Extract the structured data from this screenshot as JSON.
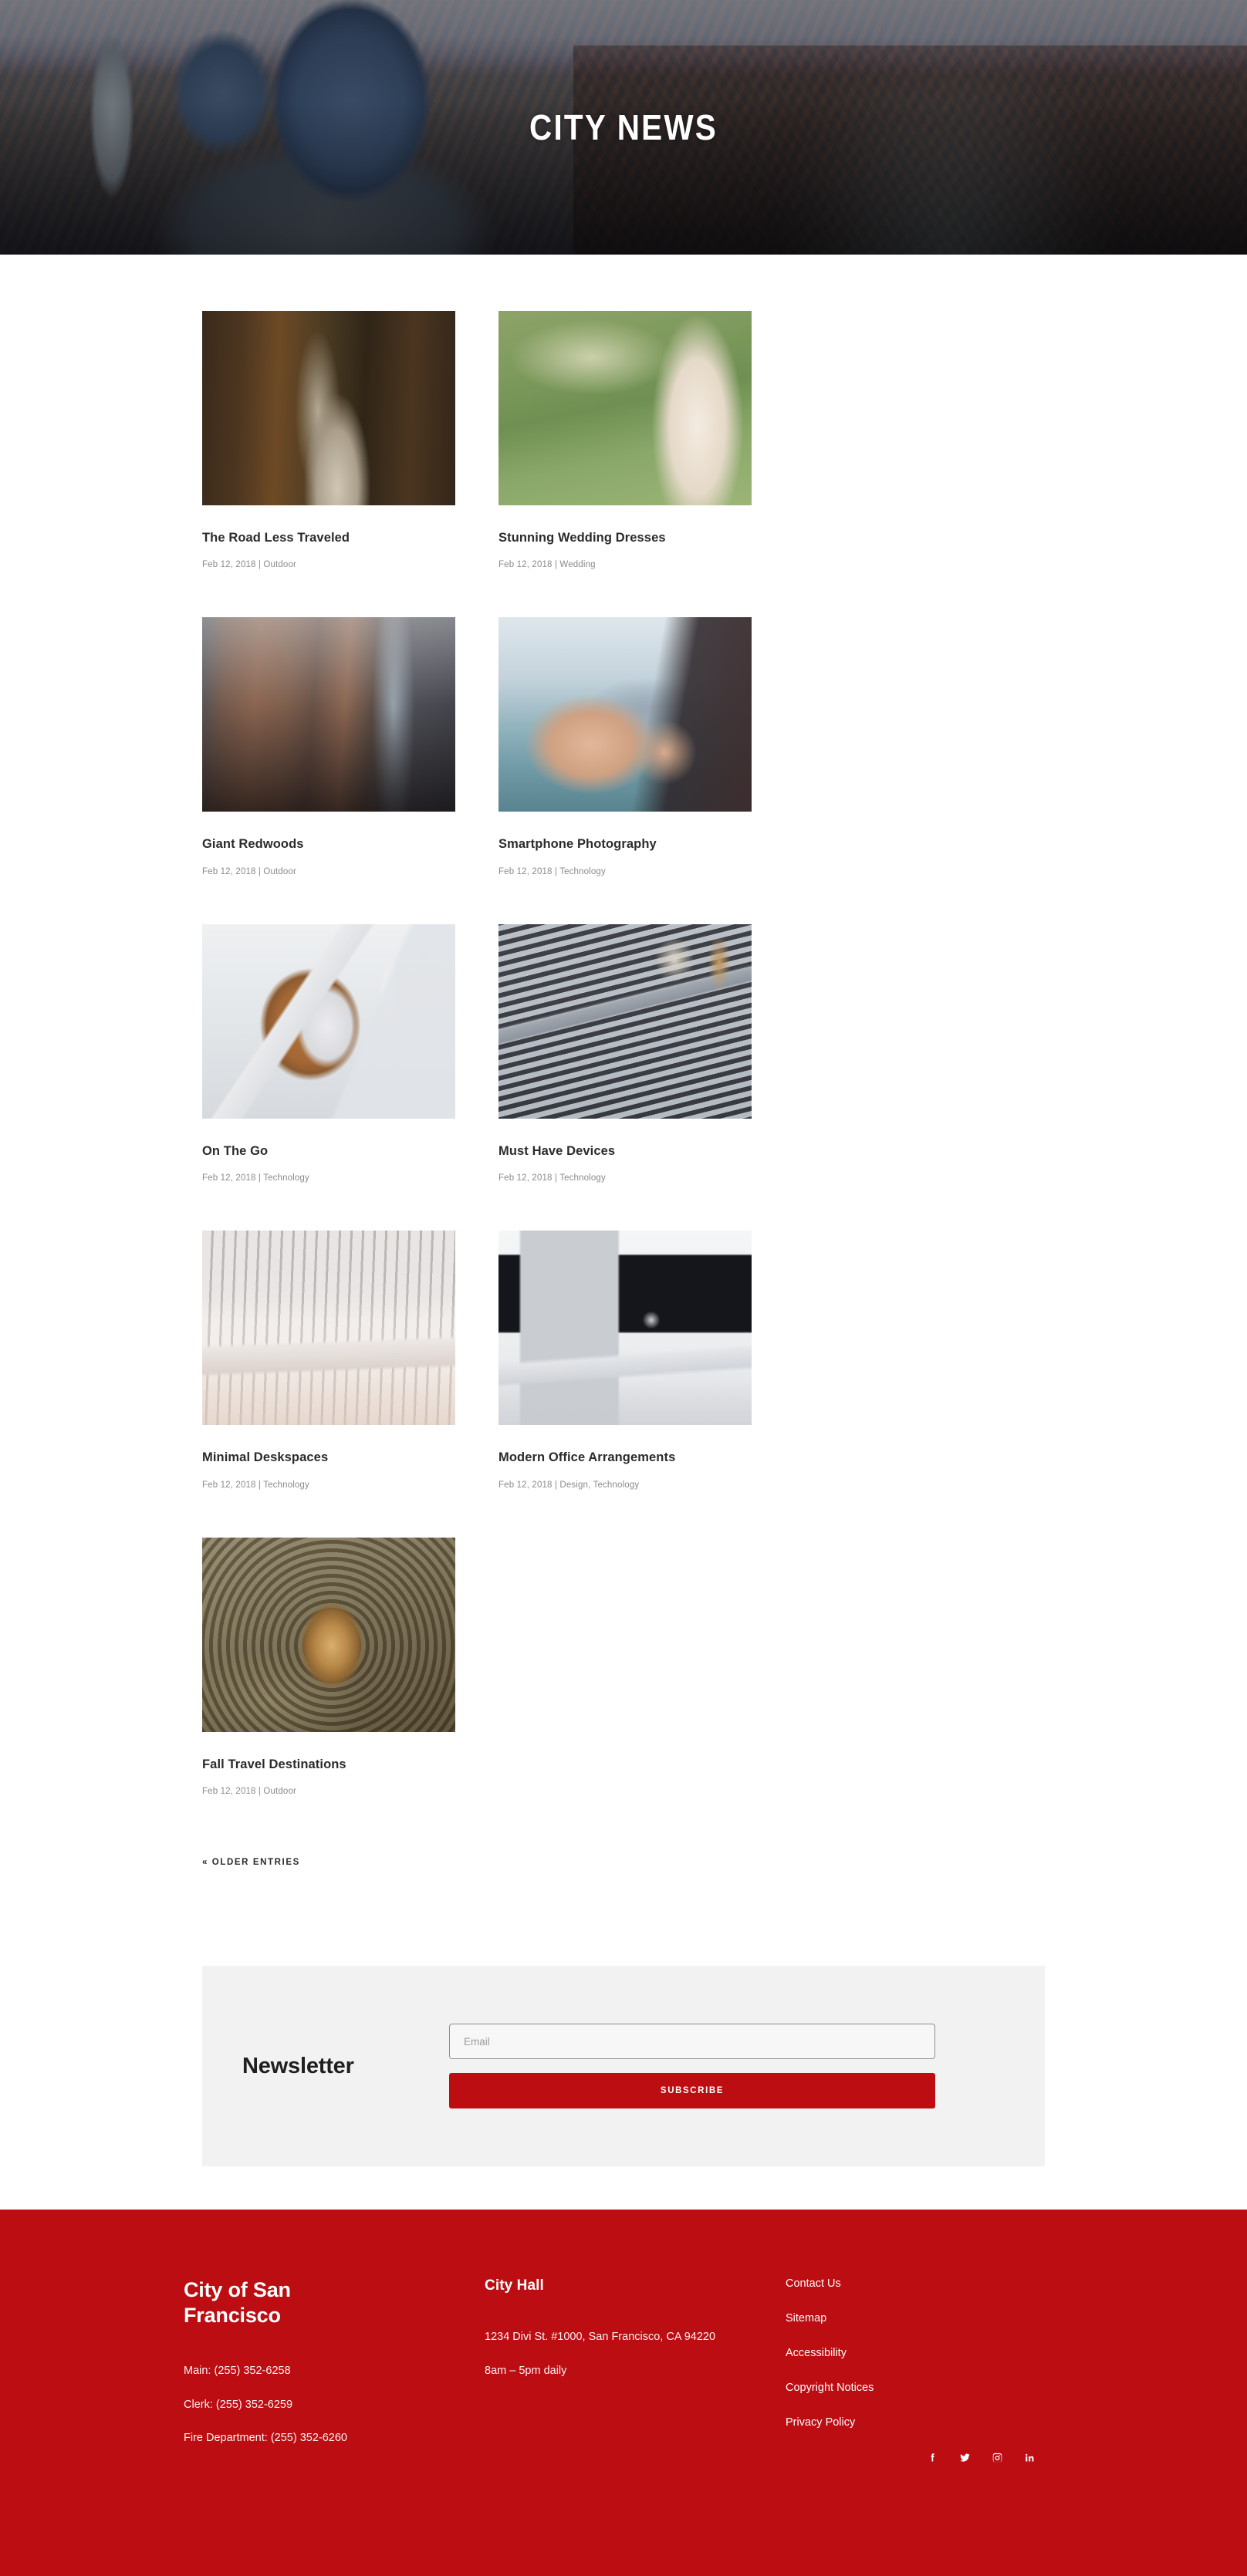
{
  "hero": {
    "title": "CITY NEWS",
    "image_alt": "venice-aerial-cityscape"
  },
  "blog": {
    "posts": [
      {
        "title": "The Road Less Traveled",
        "meta": "Feb 12, 2018 | Outdoor",
        "thumb": "ph-road"
      },
      {
        "title": "Stunning Wedding Dresses",
        "meta": "Feb 12, 2018 | Wedding",
        "thumb": "ph-wedding"
      },
      {
        "title": "Giant Redwoods",
        "meta": "Feb 12, 2018 | Outdoor",
        "thumb": "ph-redwood"
      },
      {
        "title": "Smartphone Photography",
        "meta": "Feb 12, 2018 | Technology",
        "thumb": "ph-phone"
      },
      {
        "title": "On The Go",
        "meta": "Feb 12, 2018 | Technology",
        "thumb": "ph-onthego"
      },
      {
        "title": "Must Have Devices",
        "meta": "Feb 12, 2018 | Technology",
        "thumb": "ph-devices"
      },
      {
        "title": "Minimal Deskspaces",
        "meta": "Feb 12, 2018 | Technology",
        "thumb": "ph-desk"
      },
      {
        "title": "Modern Office Arrangements",
        "meta": "Feb 12, 2018 | Design, Technology",
        "thumb": "ph-office"
      },
      {
        "title": "Fall Travel Destinations",
        "meta": "Feb 12, 2018 | Outdoor",
        "thumb": "ph-pinecone"
      }
    ],
    "pagination_older": "« OLDER ENTRIES"
  },
  "newsletter": {
    "title": "Newsletter",
    "email_placeholder": "Email",
    "email_value": "",
    "subscribe_label": "SUBSCRIBE"
  },
  "footer": {
    "org_name": "City of San Francisco",
    "phones": [
      "Main: (255) 352-6258",
      "Clerk: (255) 352-6259",
      "Fire Department: (255) 352-6260"
    ],
    "cityhall_heading": "City Hall",
    "cityhall_address": "1234 Divi St. #1000, San Francisco, CA 94220",
    "cityhall_hours": "8am – 5pm daily",
    "links": [
      "Contact Us",
      "Sitemap",
      "Accessibility",
      "Copyright Notices",
      "Privacy Policy"
    ],
    "social": [
      "facebook-icon",
      "twitter-icon",
      "instagram-icon",
      "linkedin-icon"
    ]
  },
  "colors": {
    "brand_red": "#bb0d12",
    "newsletter_bg": "#f2f2f2",
    "text_dark": "#2b2b2b",
    "text_muted": "#8b8b8b"
  }
}
